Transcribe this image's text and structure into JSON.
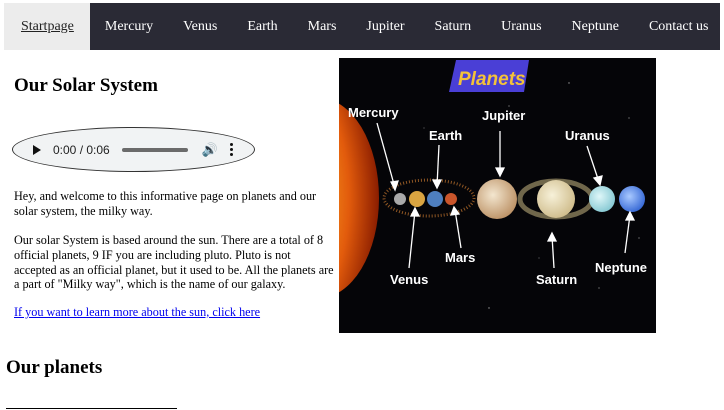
{
  "nav": {
    "items": [
      {
        "label": "Startpage",
        "active": true
      },
      {
        "label": "Mercury"
      },
      {
        "label": "Venus"
      },
      {
        "label": "Earth"
      },
      {
        "label": "Mars"
      },
      {
        "label": "Jupiter"
      },
      {
        "label": "Saturn"
      },
      {
        "label": "Uranus"
      },
      {
        "label": "Neptune"
      },
      {
        "label": "Contact us"
      }
    ]
  },
  "main": {
    "title": "Our Solar System",
    "audio": {
      "time": "0:00 / 0:06"
    },
    "intro": "Hey, and welcome to this informative page on planets and our solar system, the milky way.",
    "body": "Our solar System is based around the sun. There are a total of 8 official planets, 9 IF you are including pluto. Pluto is not accepted as an official planet, but it used to be. All the planets are a part of \"Milky way\", which is the name of our galaxy.",
    "link": "If you want to learn more about the sun, click here"
  },
  "image": {
    "banner": "Planets",
    "labels": {
      "mercury": "Mercury",
      "earth": "Earth",
      "jupiter": "Jupiter",
      "uranus": "Uranus",
      "venus": "Venus",
      "mars": "Mars",
      "saturn": "Saturn",
      "neptune": "Neptune"
    }
  },
  "planets_section": {
    "title": "Our planets"
  },
  "colors": {
    "nav_bg": "#2a2a35",
    "nav_active_bg": "#ececec",
    "link": "#0000ee"
  }
}
